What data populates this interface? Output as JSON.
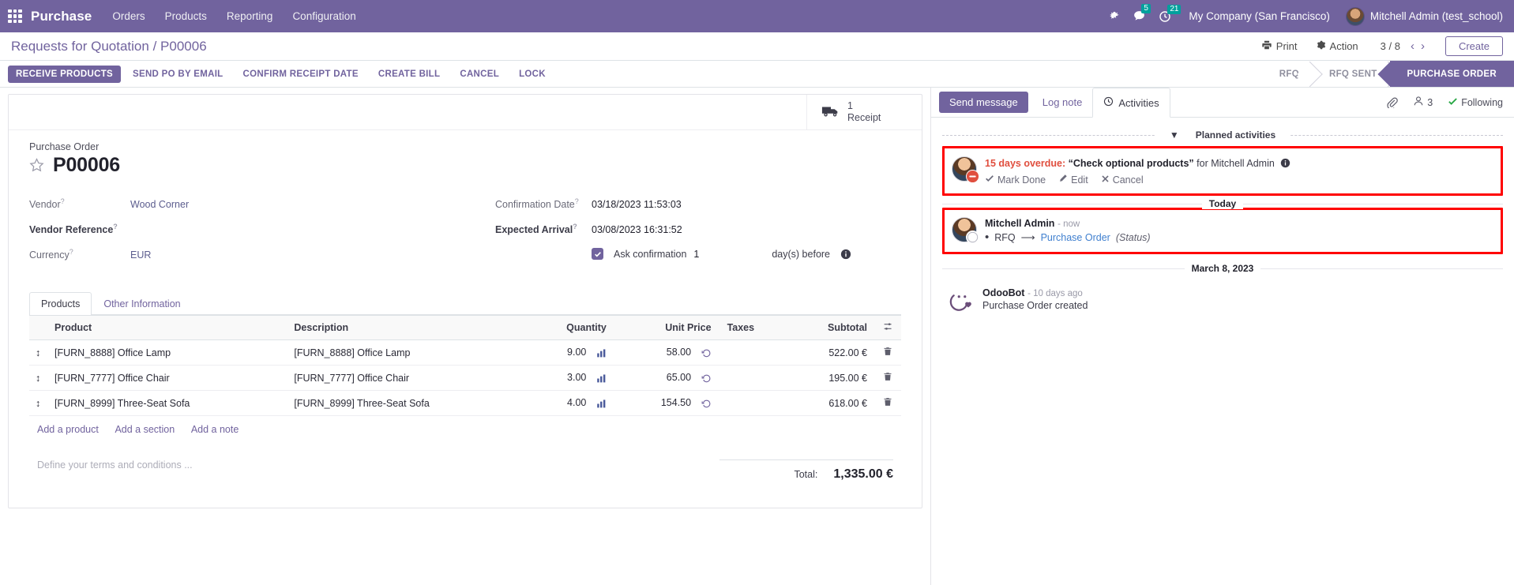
{
  "navbar": {
    "apps_icon": "apps-grid-icon",
    "brand": "Purchase",
    "menus": [
      "Orders",
      "Products",
      "Reporting",
      "Configuration"
    ],
    "bug_icon": "bug-icon",
    "messages_icon": "messages-icon",
    "messages_count": "5",
    "activities_icon": "clock-icon",
    "activities_count": "21",
    "company": "My Company (San Francisco)",
    "user": "Mitchell Admin (test_school)",
    "avatar_icon": "user-avatar",
    "brand_color": "#71639e",
    "badge_color": "#00A09D"
  },
  "control_panel": {
    "breadcrumb_parent": "Requests for Quotation",
    "breadcrumb_sep": "/",
    "breadcrumb_current": "P00006",
    "print_label": "Print",
    "print_icon": "printer-icon",
    "action_label": "Action",
    "action_icon": "gear-icon",
    "pager_value": "3 / 8",
    "prev_icon": "chevron-left-icon",
    "next_icon": "chevron-right-icon",
    "create_label": "Create"
  },
  "action_bar": {
    "buttons": [
      {
        "label": "RECEIVE PRODUCTS",
        "primary": true
      },
      {
        "label": "SEND PO BY EMAIL",
        "primary": false
      },
      {
        "label": "CONFIRM RECEIPT DATE",
        "primary": false
      },
      {
        "label": "CREATE BILL",
        "primary": false
      },
      {
        "label": "CANCEL",
        "primary": false
      },
      {
        "label": "LOCK",
        "primary": false
      }
    ],
    "statuses": [
      {
        "label": "RFQ",
        "active": false
      },
      {
        "label": "RFQ SENT",
        "active": false
      },
      {
        "label": "PURCHASE ORDER",
        "active": true
      }
    ]
  },
  "form": {
    "smart_button": {
      "icon": "truck-icon",
      "count": "1",
      "label": "Receipt"
    },
    "title_label": "Purchase Order",
    "star_icon": "star-icon",
    "po_number": "P00006",
    "left_fields": [
      {
        "label": "Vendor",
        "tip": "?",
        "value": "Wood Corner",
        "link": true,
        "bold": false
      },
      {
        "label": "Vendor Reference",
        "tip": "?",
        "value": "",
        "link": false,
        "bold": true
      },
      {
        "label": "Currency",
        "tip": "?",
        "value": "EUR",
        "link": true,
        "bold": false
      }
    ],
    "right_fields": [
      {
        "label": "Confirmation Date",
        "tip": "?",
        "value": "03/18/2023 11:53:03",
        "bold": false
      },
      {
        "label": "Expected Arrival",
        "tip": "?",
        "value": "03/08/2023 16:31:52",
        "bold": true
      }
    ],
    "ask_confirmation": {
      "checked": true,
      "label": "Ask confirmation",
      "days": "1",
      "suffix": "day(s) before",
      "info_icon": "info-icon"
    },
    "tabs": [
      {
        "label": "Products",
        "active": true
      },
      {
        "label": "Other Information",
        "active": false
      }
    ],
    "table": {
      "columns": [
        "Product",
        "Description",
        "Quantity",
        "Unit Price",
        "Taxes",
        "Subtotal"
      ],
      "optional_icon": "column-options-icon",
      "rows": [
        {
          "handle_icon": "drag-handle-icon",
          "product": "[FURN_8888] Office Lamp",
          "description": "[FURN_8888] Office Lamp",
          "quantity": "9.00",
          "qty_icon": "forecast-icon",
          "unit_price": "58.00",
          "price_icon": "history-icon",
          "taxes": "",
          "subtotal": "522.00 €",
          "delete_icon": "trash-icon"
        },
        {
          "handle_icon": "drag-handle-icon",
          "product": "[FURN_7777] Office Chair",
          "description": "[FURN_7777] Office Chair",
          "quantity": "3.00",
          "qty_icon": "forecast-icon",
          "unit_price": "65.00",
          "price_icon": "history-icon",
          "taxes": "",
          "subtotal": "195.00 €",
          "delete_icon": "trash-icon"
        },
        {
          "handle_icon": "drag-handle-icon",
          "product": "[FURN_8999] Three-Seat Sofa",
          "description": "[FURN_8999] Three-Seat Sofa",
          "quantity": "4.00",
          "qty_icon": "forecast-icon",
          "unit_price": "154.50",
          "price_icon": "history-icon",
          "taxes": "",
          "subtotal": "618.00 €",
          "delete_icon": "trash-icon"
        }
      ],
      "add_links": [
        "Add a product",
        "Add a section",
        "Add a note"
      ]
    },
    "terms_placeholder": "Define your terms and conditions ...",
    "total_label": "Total:",
    "total_value": "1,335.00 €"
  },
  "chatter": {
    "send_message": "Send message",
    "log_note": "Log note",
    "activities": "Activities",
    "activities_icon": "clock-icon",
    "attachment_icon": "paperclip-icon",
    "followers_icon": "followers-icon",
    "followers_count": "3",
    "following_label": "Following",
    "following_icon": "check-icon",
    "planned_activities_label": "Planned activities",
    "caret_icon": "caret-down-icon",
    "activity": {
      "avatar_icon": "user-avatar",
      "type_icon": "activity-warning-icon",
      "overdue": "15 days overdue:",
      "subject": "“Check optional products”",
      "for_text": "for Mitchell Admin",
      "info_icon": "info-icon",
      "mark_done": "Mark Done",
      "mark_done_icon": "check-icon",
      "edit": "Edit",
      "edit_icon": "pencil-icon",
      "cancel": "Cancel",
      "cancel_icon": "x-icon",
      "highlighted": true
    },
    "today_label": "Today",
    "messages": [
      {
        "avatar_icon": "user-avatar",
        "author": "Mitchell Admin",
        "time": "- now",
        "tracking_from": "RFQ",
        "arrow_icon": "arrow-right-icon",
        "tracking_to": "Purchase Order",
        "tracking_field": "(Status)",
        "highlighted": true
      }
    ],
    "date_divider": "March 8, 2023",
    "bot_message": {
      "avatar_icon": "odoobot-avatar",
      "author": "OdooBot",
      "time": "- 10 days ago",
      "body": "Purchase Order created"
    },
    "highlight_color": "#ff0000"
  }
}
